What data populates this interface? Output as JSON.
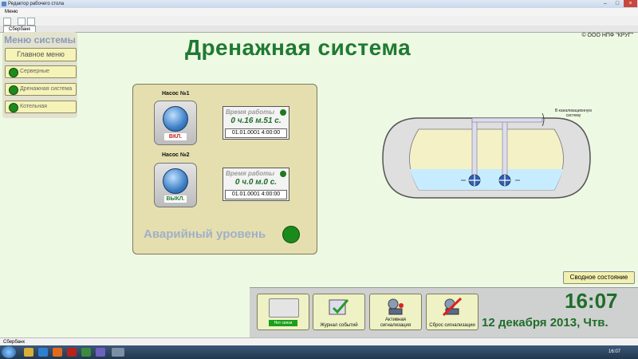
{
  "window": {
    "title": "Редактор рабочего стола",
    "menu": "Меню",
    "tab": "Сбербанк"
  },
  "copyright": "© ООО НПФ \"КРУГ\"",
  "sidebar": {
    "title": "Меню системы",
    "main_menu": "Главное меню",
    "items": [
      {
        "label": "Серверные"
      },
      {
        "label": "Дренажная система"
      },
      {
        "label": "Котельная"
      }
    ]
  },
  "page_title": "Дренажная система",
  "pumps": [
    {
      "name": "Насос №1",
      "state": "ВКЛ.",
      "state_color": "#c0241f",
      "worktime_label": "Время работы",
      "worktime": "0 ч.16 м.51 с.",
      "date": "01.01.0001 4:00:00"
    },
    {
      "name": "Насос №2",
      "state": "ВЫКЛ.",
      "state_color": "#1f7a33",
      "worktime_label": "Время работы",
      "worktime": "0 ч.0 м.0 с.",
      "date": "01.01.0001 4:00:00"
    }
  ],
  "alarm_level": {
    "label": "Аварийный уровень",
    "color": "#1a8a1a"
  },
  "tank": {
    "note": "В канализационную систему"
  },
  "summary_button": "Сводное состояние",
  "bottom_buttons": [
    {
      "label": "Нет связи",
      "icon": "device-icon"
    },
    {
      "label": "Журнал событий",
      "icon": "journal-icon"
    },
    {
      "label": "Активная сигнализация",
      "icon": "alarm-icon"
    },
    {
      "label": "Сброс сигнализации",
      "icon": "alarm-reset-icon"
    }
  ],
  "clock": {
    "time": "16:07",
    "date": "12 декабря 2013, Чтв."
  },
  "statusbar": "Сбербанк",
  "taskbar": {
    "time": "16:07"
  }
}
